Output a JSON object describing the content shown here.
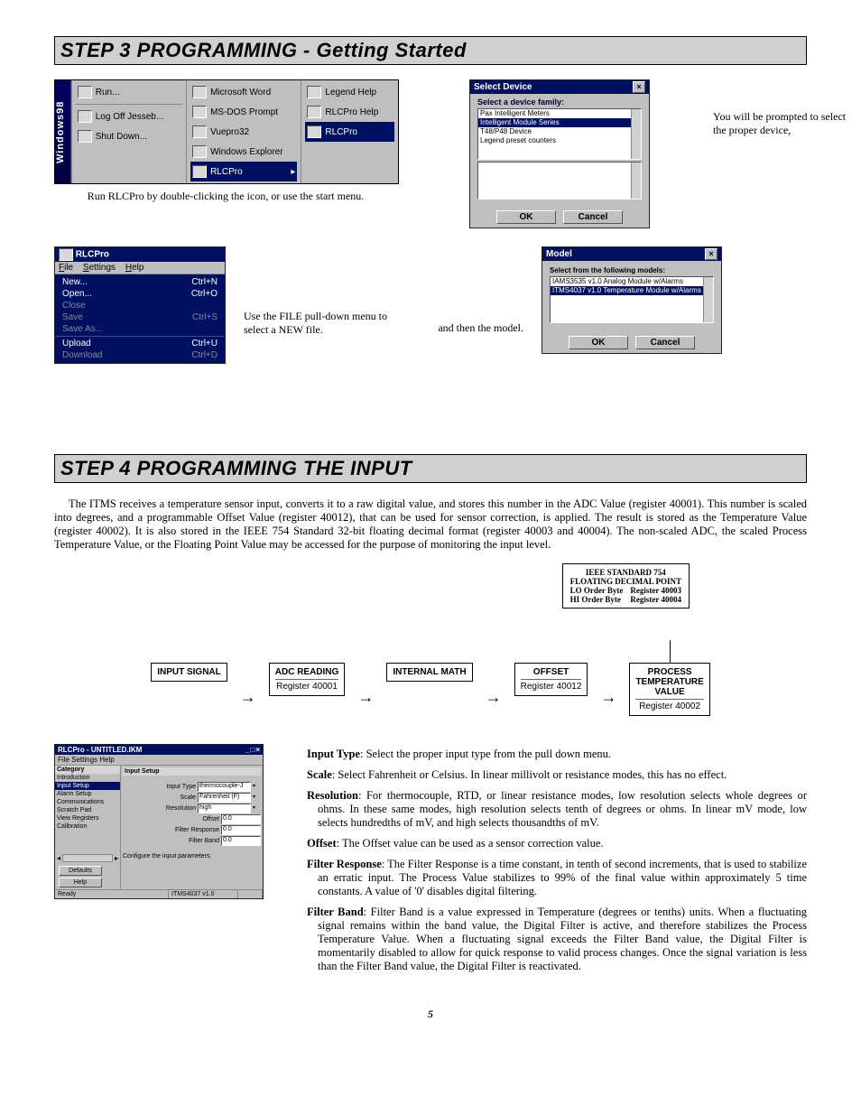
{
  "step3": {
    "title": "STEP 3  PROGRAMMING - Getting Started",
    "caption1": "Run RLCPro by double-clicking the icon, or use the start menu.",
    "prompt_text": "You will be prompted to select the proper device,",
    "use_file_text": "Use the FILE pull-down menu to select a NEW file.",
    "then_model": "and then the model."
  },
  "start_menu": {
    "os_label": "Windows98",
    "left_items": [
      "Run...",
      "Log Off Jesseb...",
      "Shut Down..."
    ],
    "mid_items": [
      "Microsoft Word",
      "MS-DOS Prompt",
      "Vuepro32",
      "Windows Explorer",
      "RLCPro"
    ],
    "right_items": [
      "Legend Help",
      "RLCPro Help",
      "RLCPro"
    ]
  },
  "select_device": {
    "title": "Select Device",
    "prompt": "Select a device family:",
    "items": [
      "Pax Intelligent Meters",
      "Intelligent Module Series",
      "T48/P48 Device",
      "Legend preset counters"
    ],
    "selected_index": 1,
    "ok": "OK",
    "cancel": "Cancel"
  },
  "rlcpro_file": {
    "title": "RLCPro",
    "menu": {
      "file": "File",
      "settings": "Settings",
      "help": "Help"
    },
    "items": [
      {
        "label": "New...",
        "shortcut": "Ctrl+N",
        "enabled": true
      },
      {
        "label": "Open...",
        "shortcut": "Ctrl+O",
        "enabled": true
      },
      {
        "label": "Close",
        "shortcut": "",
        "enabled": false
      },
      {
        "label": "Save",
        "shortcut": "Ctrl+S",
        "enabled": false
      },
      {
        "label": "Save As...",
        "shortcut": "",
        "enabled": false
      },
      {
        "label": "Upload",
        "shortcut": "Ctrl+U",
        "enabled": true
      },
      {
        "label": "Download",
        "shortcut": "Ctrl+D",
        "enabled": false
      }
    ]
  },
  "model_dlg": {
    "title": "Model",
    "prompt": "Select from the following models:",
    "items": [
      "IAMS3535   v1.0   Analog Module w/Alarms",
      "ITMS4037   v1.0   Temperature Module w/Alarms"
    ],
    "selected_index": 1,
    "ok": "OK",
    "cancel": "Cancel"
  },
  "step4": {
    "title": "STEP 4  PROGRAMMING THE INPUT",
    "intro": "The ITMS receives a temperature sensor input, converts it to a raw digital value, and stores this number in the ADC Value (register 40001). This number is scaled into degrees, and a programmable Offset Value (register 40012), that can be used for sensor correction, is applied. The result is stored as the Temperature Value (register 40002). It is also stored in the IEEE 754 Standard 32-bit floating decimal format (register 40003 and 40004). The non-scaled ADC, the scaled Process Temperature Value, or the Floating Point Value may be accessed for the purpose of monitoring the input level."
  },
  "ieee_box": {
    "line1": "IEEE STANDARD 754",
    "line2": "FLOATING DECIMAL POINT",
    "lo_label": "LO Order Byte",
    "lo_reg": "Register 40003",
    "hi_label": "HI Order Byte",
    "hi_reg": "Register 40004"
  },
  "flow": {
    "b1": "INPUT SIGNAL",
    "b2": "ADC READING",
    "b2_sub": "Register 40001",
    "b3": "INTERNAL MATH",
    "b4": "OFFSET",
    "b4_sub": "Register 40012",
    "b5a": "PROCESS",
    "b5b": "TEMPERATURE",
    "b5c": "VALUE",
    "b5_sub": "Register 40002"
  },
  "input_setup": {
    "title": "RLCPro - UNTITLED.IKM",
    "menu": "File  Settings  Help",
    "cat_label": "Category",
    "panel_title": "Input Setup",
    "cats": [
      "Introduction",
      "Input Setup",
      "Alarm Setup",
      "Communications",
      "Scratch Pad",
      "View Registers",
      "Calibration"
    ],
    "selected_cat": 1,
    "fields": {
      "input_type_lbl": "Input Type",
      "input_type_val": "thermocouple-J",
      "scale_lbl": "Scale",
      "scale_val": "Fahrenheit (F)",
      "resolution_lbl": "Resolution",
      "resolution_val": "high",
      "offset_lbl": "Offset",
      "offset_val": "0.0",
      "filter_resp_lbl": "Filter Response",
      "filter_resp_val": "0.0",
      "filter_band_lbl": "Filter Band",
      "filter_band_val": "0.0"
    },
    "note": "Configure the input parameters.",
    "defaults_btn": "Defaults",
    "help_btn": "Help",
    "status_left": "Ready",
    "status_mid": "ITMS4037 v1.0"
  },
  "defs": {
    "input_type": "Input Type: Select the proper input type from the pull down menu.",
    "scale": "Scale: Select Fahrenheit or Celsius. In linear millivolt or resistance modes, this has no effect.",
    "resolution": "Resolution: For thermocouple, RTD, or linear resistance modes, low resolution selects whole degrees or ohms. In these same modes, high resolution selects tenth of degrees or ohms. In linear mV mode, low selects hundredths of mV, and high selects thousandths of mV.",
    "offset": "Offset: The Offset value can be used as a sensor correction value.",
    "filter_response": "Filter Response: The Filter Response is a time constant, in tenth of second increments, that is used to stabilize an erratic input. The Process Value stabilizes to 99% of the final value within approximately 5 time constants. A value of '0' disables digital filtering.",
    "filter_band": "Filter Band: Filter Band is a value expressed in Temperature (degrees or tenths) units. When a fluctuating signal remains within the band value, the Digital Filter is active, and therefore stabilizes the Process Temperature Value.  When a fluctuating signal exceeds the Filter Band value, the Digital Filter is momentarily disabled to allow for quick response to valid process changes. Once the signal variation is less than the Filter Band value, the Digital Filter is reactivated."
  },
  "page_num": "5"
}
